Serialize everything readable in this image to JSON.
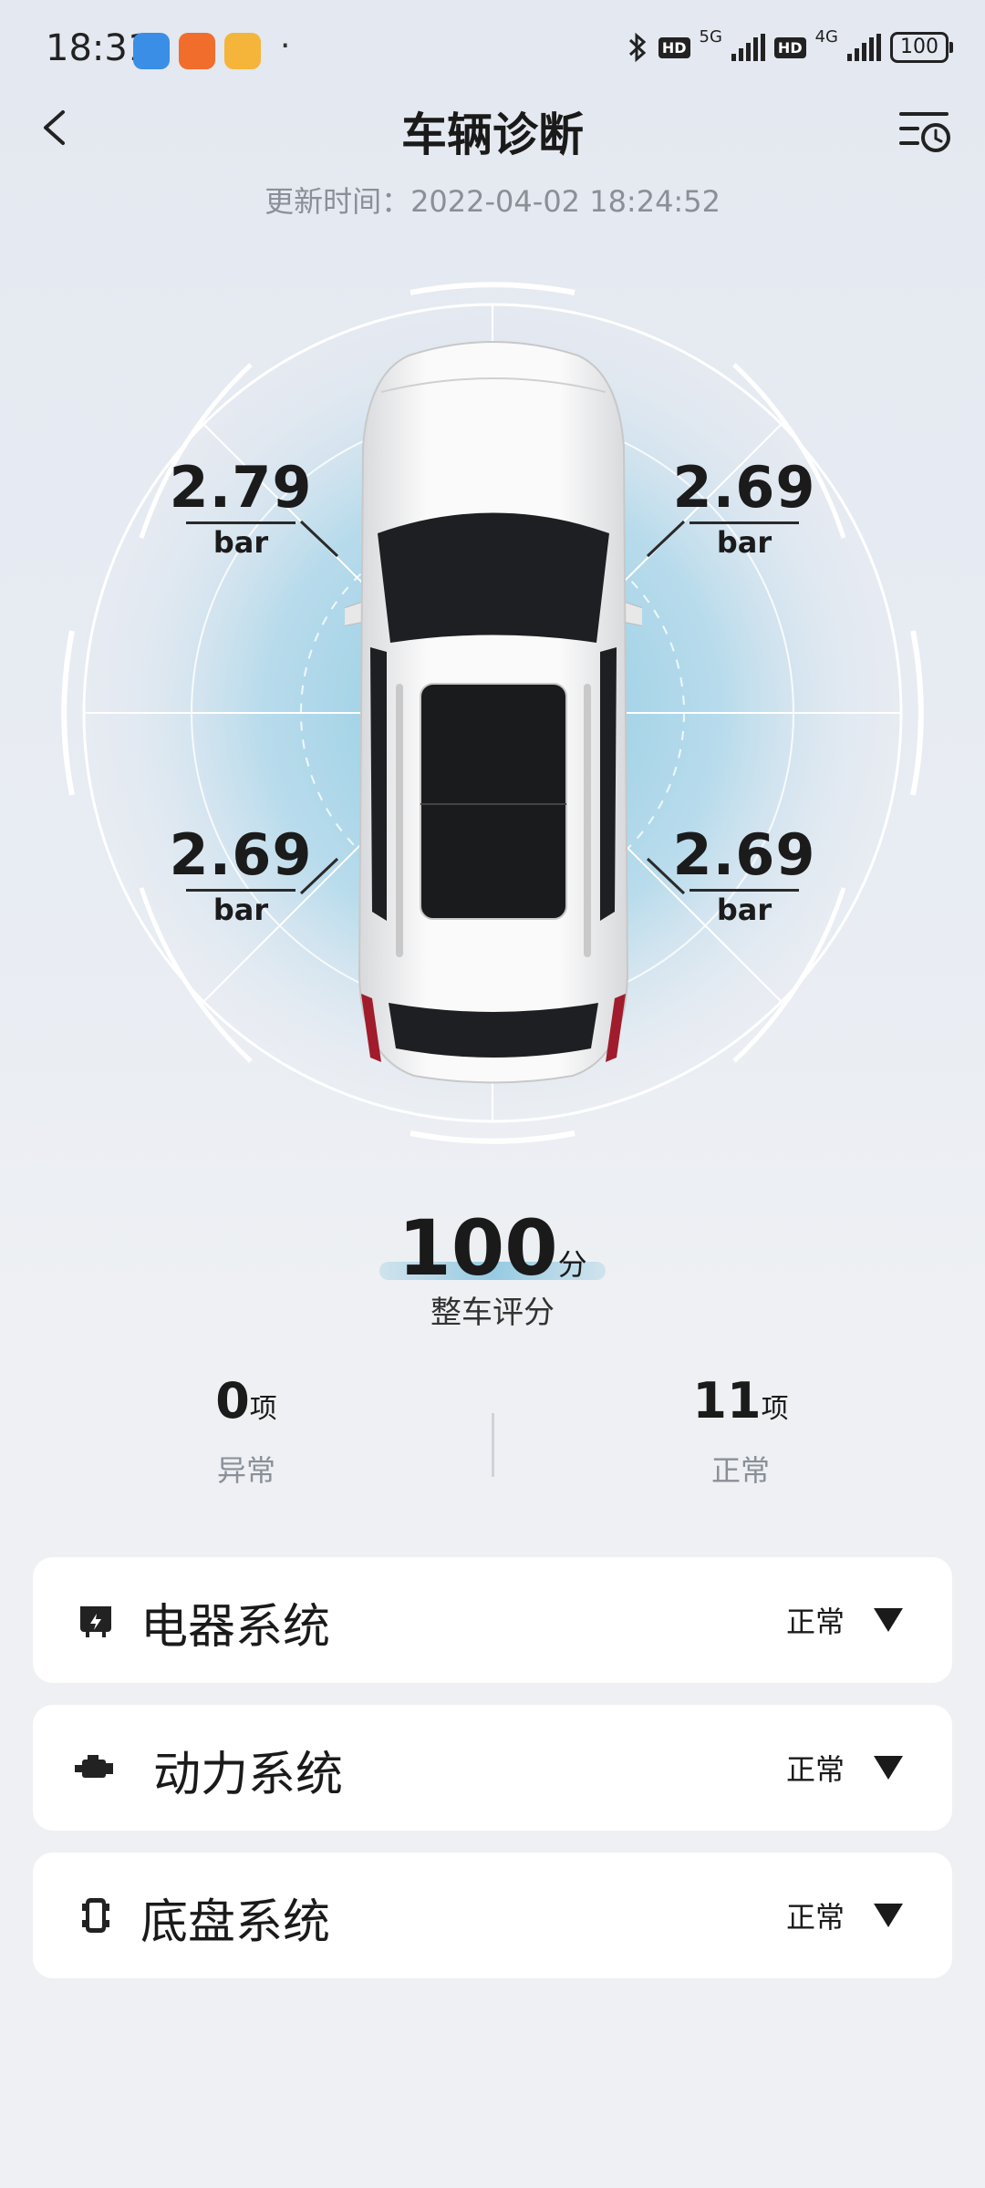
{
  "status_bar": {
    "time": "18:31",
    "network_5g": "5G",
    "network_4g": "4G",
    "hd_label": "HD",
    "battery": "100"
  },
  "header": {
    "title": "车辆诊断",
    "update_time": "更新时间：2022-04-02 18:24:52"
  },
  "tires": {
    "front_left": {
      "value": "2.79",
      "unit": "bar"
    },
    "front_right": {
      "value": "2.69",
      "unit": "bar"
    },
    "rear_left": {
      "value": "2.69",
      "unit": "bar"
    },
    "rear_right": {
      "value": "2.69",
      "unit": "bar"
    }
  },
  "score": {
    "value": "100",
    "unit": "分",
    "label": "整车评分"
  },
  "stats": {
    "abnormal": {
      "count": "0",
      "unit": "项",
      "label": "异常"
    },
    "normal": {
      "count": "11",
      "unit": "项",
      "label": "正常"
    }
  },
  "systems": [
    {
      "name": "电器系统",
      "status": "正常",
      "icon": "electrical-icon"
    },
    {
      "name": "动力系统",
      "status": "正常",
      "icon": "engine-icon"
    },
    {
      "name": "底盘系统",
      "status": "正常",
      "icon": "chassis-icon"
    }
  ],
  "colors": {
    "accent_blue": "#7ec4df",
    "background": "#e8ecf3",
    "card": "#ffffff"
  }
}
